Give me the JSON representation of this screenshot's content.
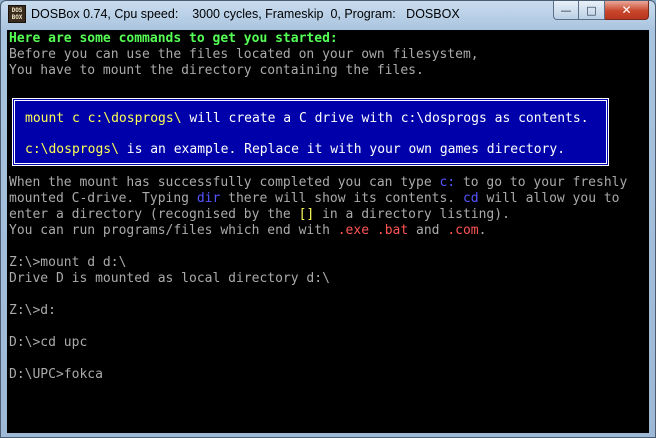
{
  "window": {
    "title": "DOSBox 0.74, Cpu speed:    3000 cycles, Frameskip  0, Program:   DOSBOX",
    "icon_label": "DOS BOX",
    "buttons": {
      "minimize": "—",
      "maximize": "□",
      "close": "✕"
    }
  },
  "console": {
    "intro_heading": "Here are some commands to get you started:",
    "intro_1": "Before you can use the files located on your own filesystem,",
    "intro_2": "You have to mount the directory containing the files.",
    "box": {
      "l1_cmd": "mount c c:\\dosprogs\\",
      "l1_text": " will create a C drive with c:\\dosprogs as contents.",
      "l2_cmd": "c:\\dosprogs\\",
      "l2_text": " is an example. Replace it with your own games directory."
    },
    "p1_a": "When the mount has successfully completed you can type ",
    "p1_c": "c:",
    "p1_b": " to go to your freshly",
    "p2_a": "mounted C-drive. Typing ",
    "p2_dir": "dir",
    "p2_b": " there will show its contents. ",
    "p2_cd": "cd",
    "p2_c": " will allow you to",
    "p3_a": "enter a directory (recognised by the ",
    "p3_brackets": "[]",
    "p3_b": " in a directory listing).",
    "p4_a": "You can run programs/files which end with ",
    "p4_exe": ".exe",
    "p4_bat": ".bat",
    "p4_and": " and ",
    "p4_com": ".com",
    "p4_end": ".",
    "cmd1": "Z:\\>mount d d:\\",
    "out1": "Drive D is mounted as local directory d:\\",
    "cmd2": "Z:\\>d:",
    "cmd3": "D:\\>cd upc",
    "cmd4": "D:\\UPC>fokca"
  }
}
